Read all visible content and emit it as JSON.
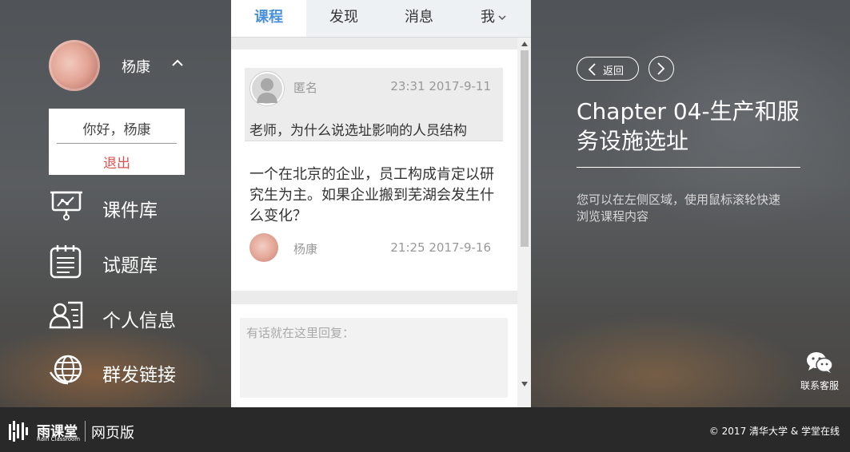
{
  "user": {
    "name": "杨康",
    "greeting": "你好，杨康",
    "logout_label": "退出"
  },
  "sidebar": {
    "items": [
      {
        "label": "课件库",
        "icon": "presentation-board-icon"
      },
      {
        "label": "试题库",
        "icon": "notepad-icon"
      },
      {
        "label": "个人信息",
        "icon": "profile-card-icon"
      },
      {
        "label": "群发链接",
        "icon": "globe-icon"
      }
    ]
  },
  "tabs": [
    {
      "label": "课程",
      "active": true
    },
    {
      "label": "发现",
      "active": false
    },
    {
      "label": "消息",
      "active": false
    },
    {
      "label": "我",
      "active": false
    }
  ],
  "question": {
    "author": "匿名",
    "time": "23:31 2017-9-11",
    "text": "老师，为什么说选址影响的人员结构"
  },
  "answer": {
    "text": "一个在北京的企业，员工构成肯定以研究生为主。如果企业搬到芜湖会发生什么变化？",
    "author": "杨康",
    "time": "21:25 2017-9-16"
  },
  "reply": {
    "placeholder": "有话就在这里回复："
  },
  "right_panel": {
    "back_label": "返回",
    "chapter_title": "Chapter 04-生产和服务设施选址",
    "hint": "您可以在左侧区域，使用鼠标滚轮快速浏览课程内容",
    "contact_label": "联系客服"
  },
  "footer": {
    "logo_cn": "雨课堂",
    "logo_en": "Rain Classroom",
    "web_version": "网页版",
    "copyright": "© 2017 清华大学 & 学堂在线"
  },
  "colors": {
    "accent": "#4a90d9",
    "logout": "#d9534f",
    "footer_bg": "#292929"
  }
}
